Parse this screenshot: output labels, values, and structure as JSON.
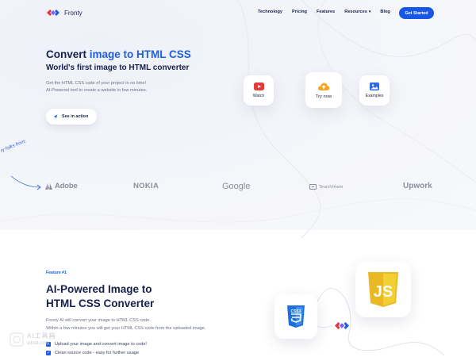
{
  "colors": {
    "accent": "#1f5de6",
    "primary_button": "#1757e6",
    "heading": "#17204a",
    "muted_text": "#6a7089",
    "brand_gray": "#8a8f9e"
  },
  "nav": {
    "logo_text": "Fronty",
    "links": [
      "Technology",
      "Pricing",
      "Features",
      "Resources",
      "Blog"
    ],
    "cta": "Get Started"
  },
  "hero": {
    "title_prefix": "Convert ",
    "title_accent": "image to HTML CSS",
    "subtitle": "World's first image to HTML converter",
    "desc_line1": "Get the HTML CSS code of your project in no time!",
    "desc_line2": "AI-Powered tool to create a website in few minutes.",
    "action_button": "See in action",
    "cards": {
      "watch": {
        "label": "Watch",
        "icon": "youtube-play-icon"
      },
      "try": {
        "label": "Try now",
        "icon": "upload-cloud-icon"
      },
      "examples": {
        "label": "Examples",
        "icon": "image-gallery-icon"
      }
    }
  },
  "trusted": {
    "label": "ry folks from:",
    "brands": [
      "Adobe",
      "NOKIA",
      "Google",
      "TeamViewer",
      "Upwork"
    ]
  },
  "feature": {
    "tag": "Feature #1",
    "title_line1": "AI-Powered Image to",
    "title_line2": "HTML CSS Converter",
    "desc_line1": "Fronty AI will convert your image to HTML CSS code.",
    "desc_line2": "Within a few minutes you will get your HTML CSS code from the uploaded image.",
    "checks": [
      "Upload your image and convert image to code!",
      "Clean source code - easy for further usage"
    ],
    "badges": {
      "css": "CSS3",
      "js": "JS"
    }
  },
  "watermark": {
    "line1": "AI工具箱",
    "line2": "aitool.com"
  }
}
